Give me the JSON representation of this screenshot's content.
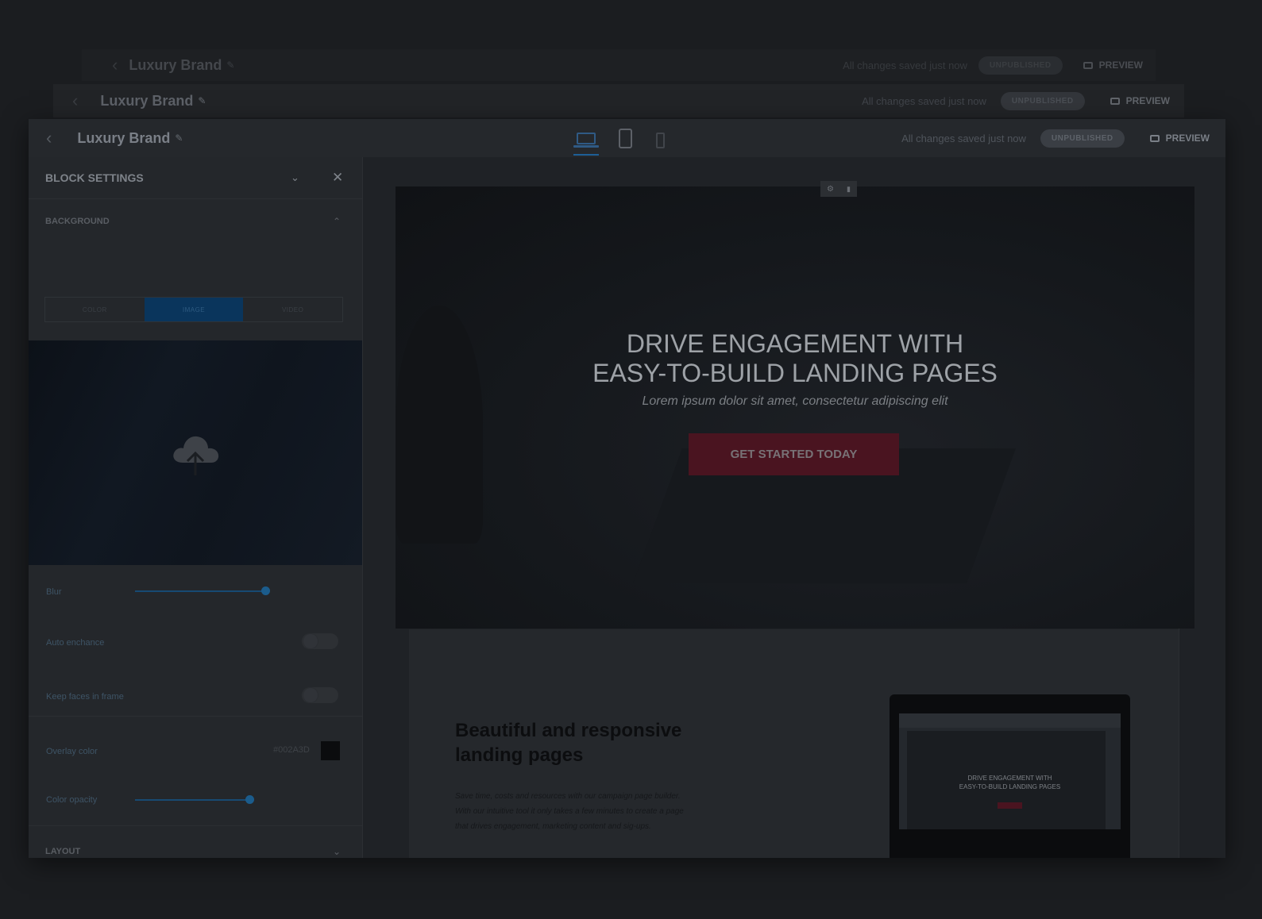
{
  "app": {
    "brand": "Luxury Brand",
    "save_status": "All changes saved just now",
    "publish_status": "UNPUBLISHED",
    "preview_label": "PREVIEW"
  },
  "sidebar": {
    "title": "BLOCK SETTINGS",
    "background_section": "BACKGROUND",
    "tabs": [
      "COLOR",
      "IMAGE",
      "VIDEO"
    ],
    "active_tab": "IMAGE",
    "blur_label": "Blur",
    "blur_value": 0.64,
    "auto_enhance_label": "Auto enchance",
    "auto_enhance_on": false,
    "keep_faces_label": "Keep faces in frame",
    "keep_faces_on": false,
    "overlay_color_label": "Overlay color",
    "overlay_color_value": "#002A3D",
    "color_opacity_label": "Color opacity",
    "color_opacity_value": 0.55,
    "layout_section": "LAYOUT"
  },
  "hero": {
    "title_line1": "DRIVE ENGAGEMENT WITH",
    "title_line2": "EASY-TO-BUILD LANDING PAGES",
    "subtitle": "Lorem ipsum dolor sit amet, consectetur adipiscing elit",
    "cta": "GET STARTED TODAY"
  },
  "feature": {
    "title_line1": "Beautiful and responsive",
    "title_line2": "landing pages",
    "body_line1": "Save time, costs and resources with our campaign page builder.",
    "body_line2": "With our intuitive tool it only takes a few minutes to create a page",
    "body_line3": "that drives engagement, marketing content and sig-ups.",
    "monitor_title_line1": "DRIVE ENGAGEMENT WITH",
    "monitor_title_line2": "EASY-TO-BUILD LANDING PAGES"
  },
  "colors": {
    "accent": "#0a355c",
    "cta": "#4a1420",
    "overlay_swatch": "#0b0c0e"
  }
}
